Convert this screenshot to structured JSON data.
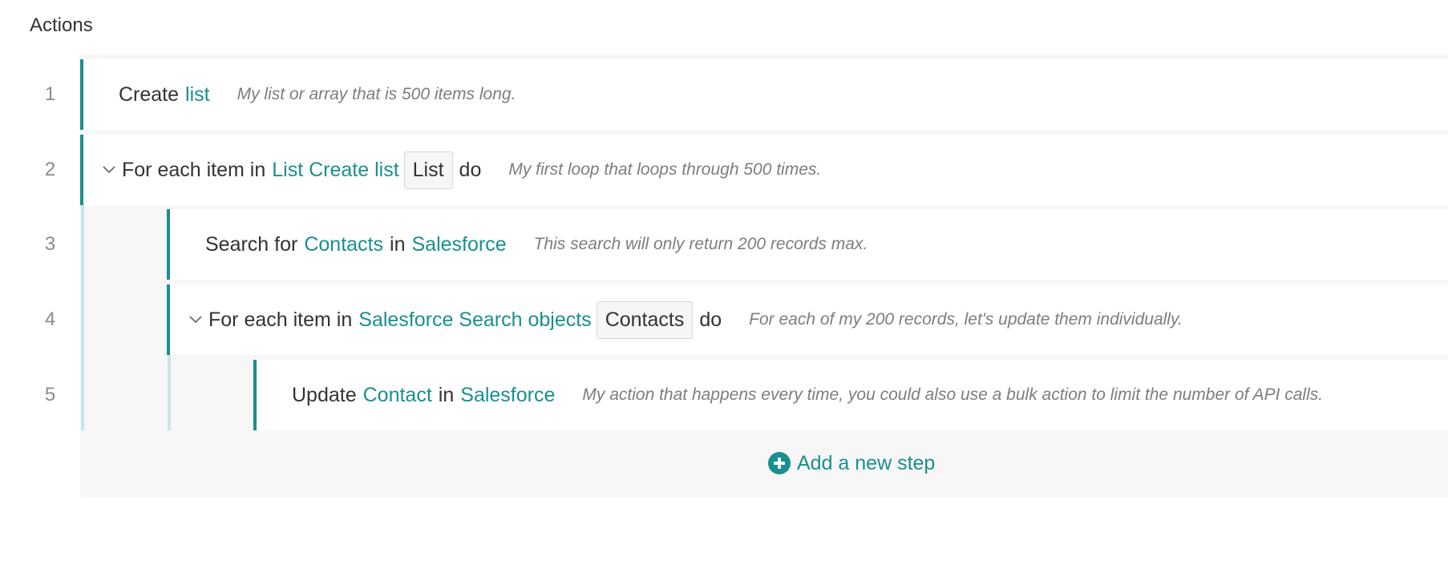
{
  "header": {
    "title": "Actions"
  },
  "steps": [
    {
      "number": "1",
      "verb": "Create",
      "object": "list",
      "note": "My list or array that is 500 items long."
    },
    {
      "number": "2",
      "prefix": "For each item in",
      "source": "List Create list",
      "var": "List",
      "suffix": "do",
      "note": "My first loop that loops through 500 times."
    },
    {
      "number": "3",
      "verb": "Search for",
      "object": "Contacts",
      "conn": "in",
      "app": "Salesforce",
      "note": "This search will only return 200 records max."
    },
    {
      "number": "4",
      "prefix": "For each item in",
      "source": "Salesforce Search objects",
      "var": "Contacts",
      "suffix": "do",
      "note": "For each of my 200 records, let's update them individually."
    },
    {
      "number": "5",
      "verb": "Update",
      "object": "Contact",
      "conn": "in",
      "app": "Salesforce",
      "note": "My action that happens every time, you could also use a bulk action to limit the number of API calls."
    }
  ],
  "add_step": {
    "label": "Add a new step",
    "icon": "plus-circle-icon"
  },
  "colors": {
    "accent": "#1a8f8f",
    "nest_stripe": "#c6e6ea",
    "note": "#7d7d7d",
    "background": "#f7f7f7"
  }
}
